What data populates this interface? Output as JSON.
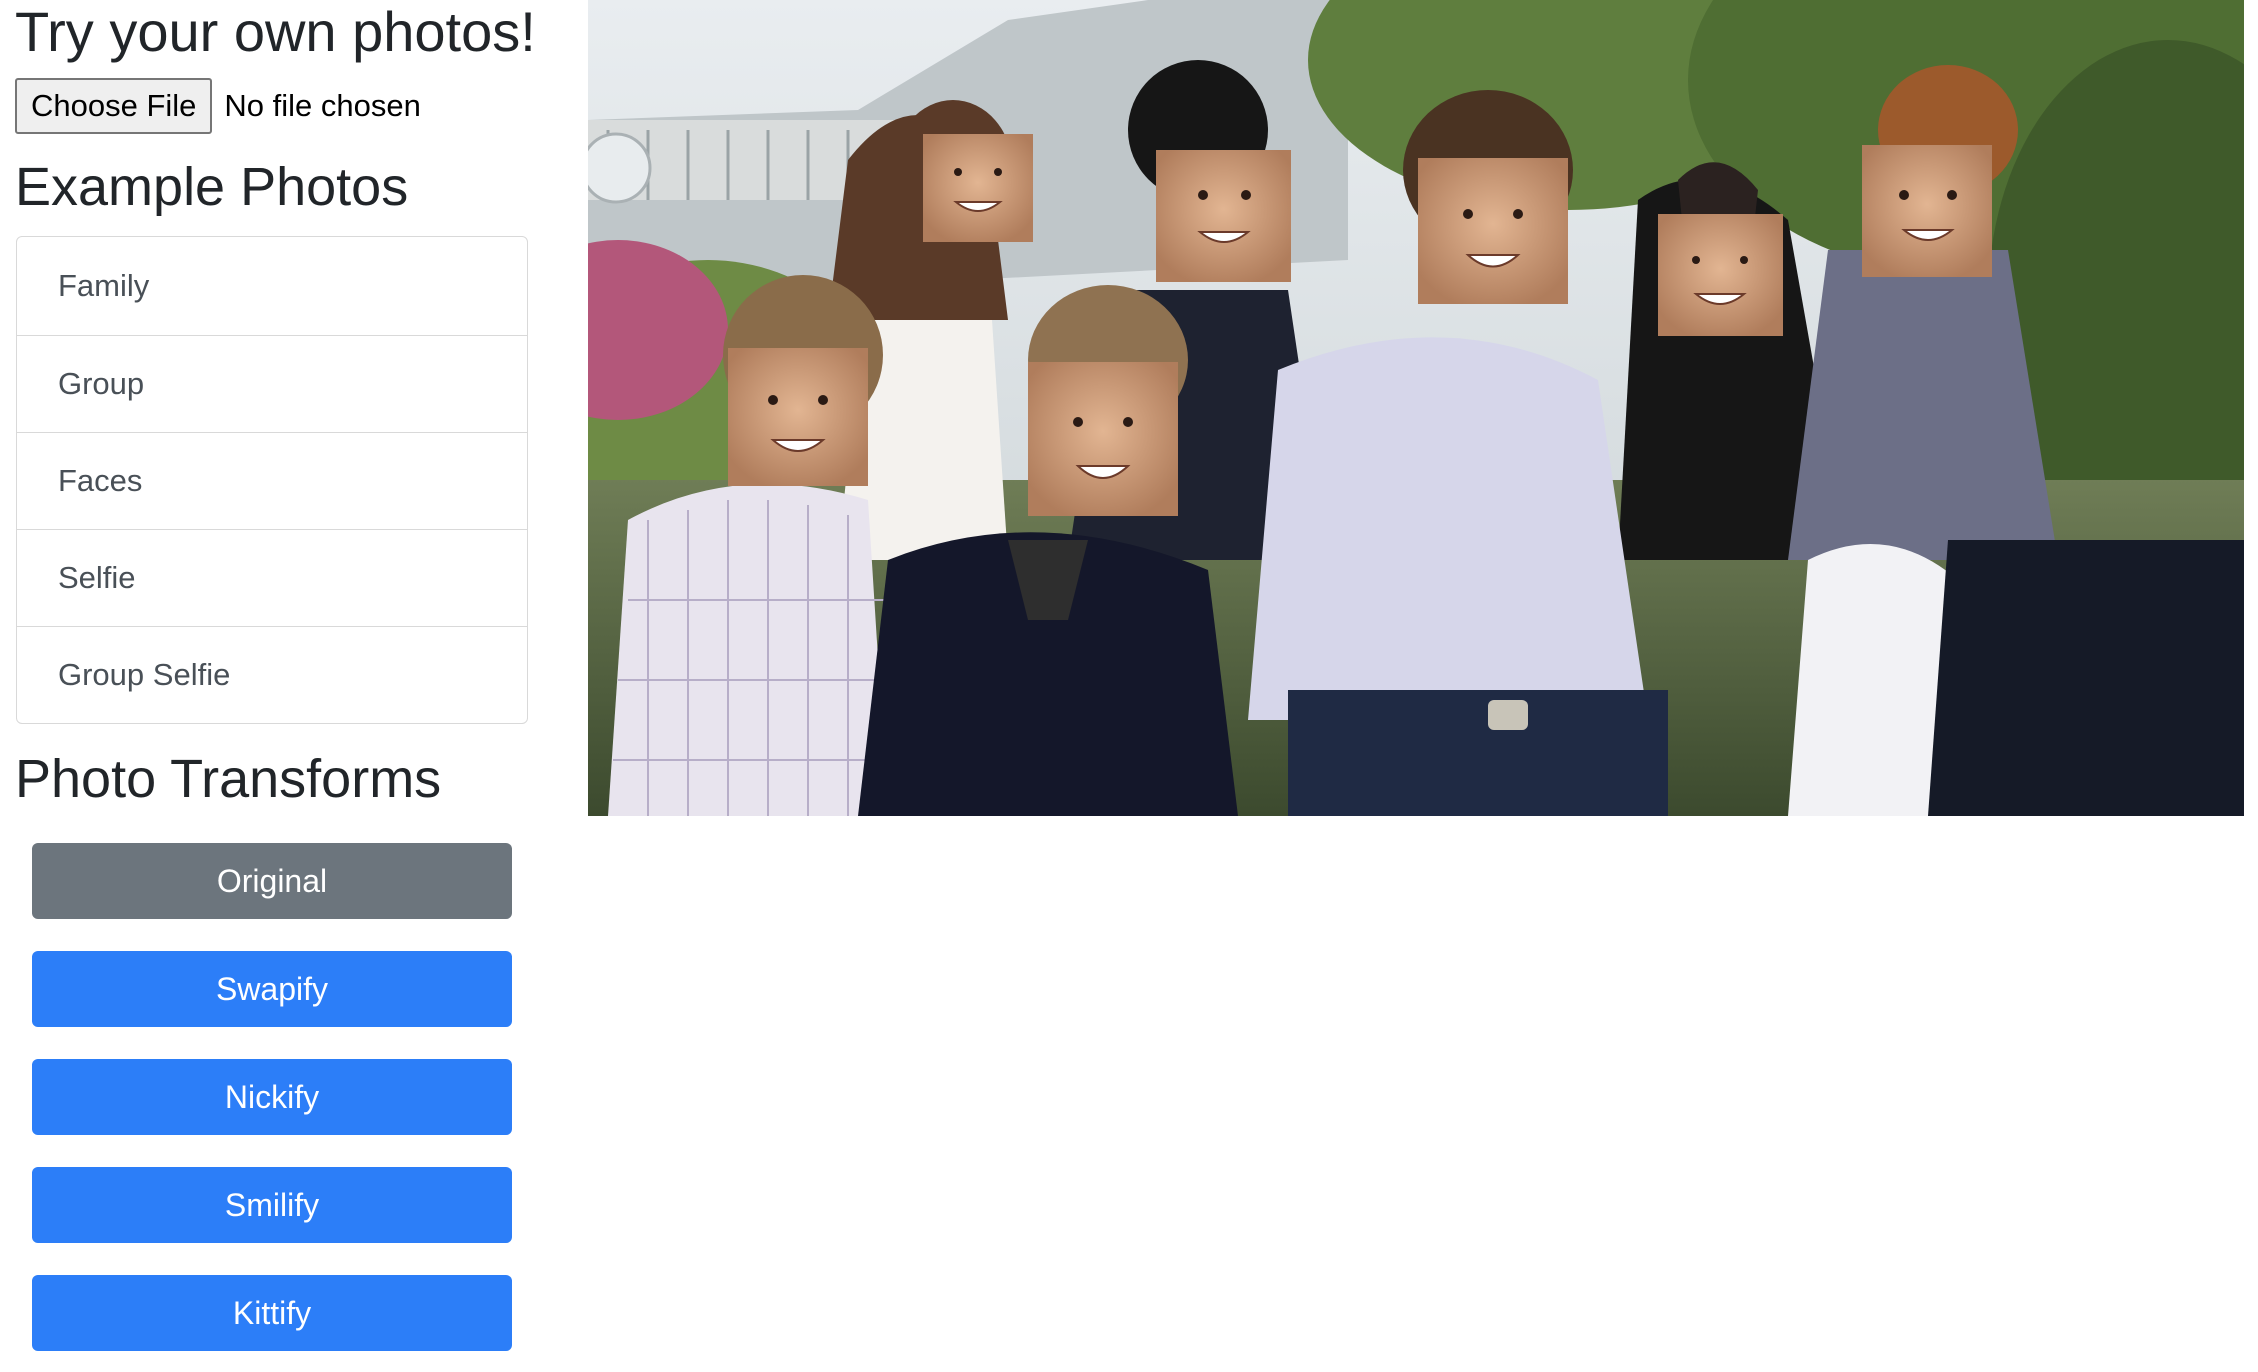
{
  "upload": {
    "heading": "Try your own photos!",
    "button_label": "Choose File",
    "status": "No file chosen"
  },
  "examples": {
    "heading": "Example Photos",
    "items": [
      {
        "label": "Family"
      },
      {
        "label": "Group"
      },
      {
        "label": "Faces"
      },
      {
        "label": "Selfie"
      },
      {
        "label": "Group Selfie"
      }
    ]
  },
  "transforms": {
    "heading": "Photo Transforms",
    "buttons": [
      {
        "label": "Original",
        "style": "secondary"
      },
      {
        "label": "Swapify",
        "style": "primary"
      },
      {
        "label": "Nickify",
        "style": "primary"
      },
      {
        "label": "Smilify",
        "style": "primary"
      },
      {
        "label": "Kittify",
        "style": "primary"
      }
    ]
  },
  "colors": {
    "primary": "#2c7ef8",
    "secondary": "#6c757d",
    "text": "#212529"
  },
  "photo": {
    "subject": "group photo with swapped faces"
  }
}
